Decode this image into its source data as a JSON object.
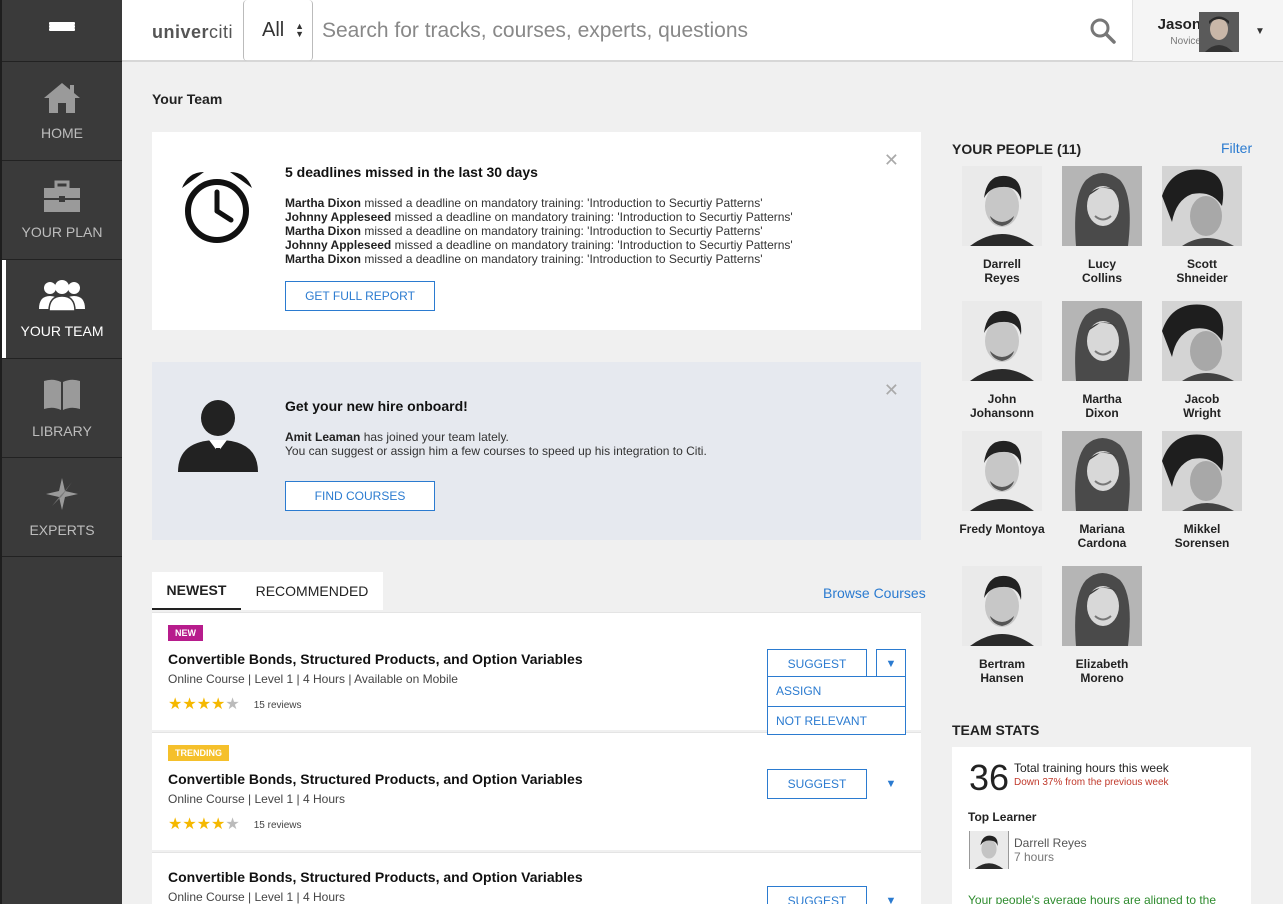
{
  "header": {
    "logo": "univer",
    "logo_suffix": "citi",
    "scope_value": "All",
    "search_placeholder": "Search for tracks, courses, experts, questions",
    "user_name": "Jason",
    "user_rank": "Novice"
  },
  "sidebar": {
    "items": [
      {
        "label": "HOME",
        "icon": "home-icon"
      },
      {
        "label": "YOUR PLAN",
        "icon": "briefcase-icon"
      },
      {
        "label": "YOUR TEAM",
        "icon": "team-icon",
        "active": true
      },
      {
        "label": "LIBRARY",
        "icon": "book-icon"
      },
      {
        "label": "EXPERTS",
        "icon": "compass-icon"
      }
    ]
  },
  "page": {
    "title": "Your Team"
  },
  "deadline_card": {
    "title": "5 deadlines missed in the last 30 days",
    "message": "missed a deadline on mandatory training: 'Introduction to Securtiy Patterns'",
    "people": [
      "Martha Dixon",
      "Johnny Appleseed",
      "Martha Dixon",
      "Johnny Appleseed",
      "Martha Dixon"
    ],
    "button": "GET FULL REPORT"
  },
  "onboard_card": {
    "title": "Get your new hire onboard!",
    "person": "Amit Leaman",
    "line1": "has joined your team lately.",
    "line2": "You can suggest or assign him a few courses to speed up his integration to Citi.",
    "button": "FIND COURSES"
  },
  "tabs": [
    {
      "label": "NEWEST",
      "active": true
    },
    {
      "label": "RECOMMENDED",
      "active": false
    }
  ],
  "browse_link": "Browse Courses",
  "courses": [
    {
      "badge": "NEW",
      "title": "Convertible Bonds, Structured Products, and Option Variables",
      "meta": "Online Course  |  Level 1  |  4 Hours  |  Available on Mobile",
      "rating": 4,
      "reviews": "15 reviews",
      "suggest": "SUGGEST"
    },
    {
      "badge": "TRENDING",
      "title": "Convertible Bonds, Structured Products, and Option Variables",
      "meta": "Online Course  |  Level 1  |  4 Hours",
      "rating": 4,
      "reviews": "15 reviews",
      "suggest": "SUGGEST"
    },
    {
      "badge": "",
      "title": "Convertible Bonds, Structured Products, and Option Variables",
      "meta": "Online Course  |  Level 1  |  4 Hours",
      "suggest": "SUGGEST"
    }
  ],
  "dropdown": {
    "assign": "ASSIGN",
    "not_relevant": "NOT RELEVANT"
  },
  "people": {
    "title": "YOUR PEOPLE (11)",
    "filter": "Filter",
    "list": [
      {
        "name": "Darrell\nReyes",
        "photo": "man-a"
      },
      {
        "name": "Lucy\nCollins",
        "photo": "woman"
      },
      {
        "name": "Scott\nShneider",
        "photo": "man-b"
      },
      {
        "name": "John\nJohansonn",
        "photo": "man-a"
      },
      {
        "name": "Martha\nDixon",
        "photo": "woman"
      },
      {
        "name": "Jacob\nWright",
        "photo": "man-b"
      },
      {
        "name": "Fredy Montoya",
        "photo": "man-a"
      },
      {
        "name": "Mariana\nCardona",
        "photo": "woman"
      },
      {
        "name": "Mikkel\nSorensen",
        "photo": "man-b"
      },
      {
        "name": "Bertram\nHansen",
        "photo": "man-a"
      },
      {
        "name": "Elizabeth\nMoreno",
        "photo": "woman"
      }
    ]
  },
  "team_stats": {
    "title": "TEAM STATS",
    "hours": "36",
    "hours_label": "Total training hours this week",
    "change": "Down 37% from the previous week",
    "top_learner_label": "Top Learner",
    "top_learner_name": "Darrell Reyes",
    "top_learner_hours": "7 hours",
    "note": "Your people's average hours are aligned to the"
  },
  "colors": {
    "accent": "#2b7bd0",
    "sidebar": "#3a3a3a",
    "new_badge": "#b71c8c",
    "trending_badge": "#f5c02b",
    "star": "#f5b800"
  }
}
